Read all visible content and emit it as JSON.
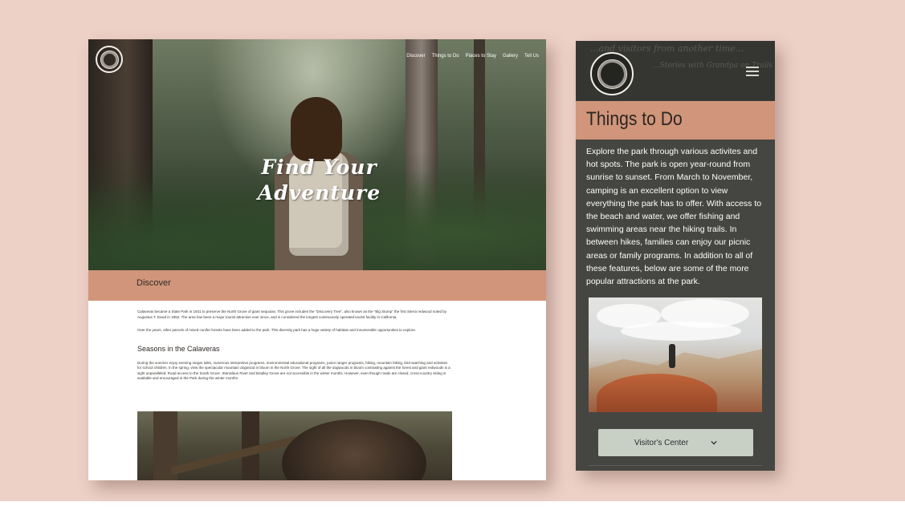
{
  "desktop": {
    "nav": [
      "Discover",
      "Things to Do",
      "Places to Stay",
      "Gallery",
      "Tell Us"
    ],
    "hero_title_line1": "Find Your",
    "hero_title_line2": "Adventure",
    "section_title": "Discover",
    "paragraphs": [
      "Calaveras became a State Park in 1931 to preserve the North Grove of giant sequoias. This grove includes the \"Discovery Tree\", also known as the \"Big Stump\" the first Sierra redwood noted by Augustus T. Dowd in 1852. The area has been a major tourist attraction ever since, and is considered the longest continuously operated tourist facility in California.",
      "Over the years, other parcels of mixed conifer forests have been added to the park. This diversity park has a huge variety of habitats and innumerable opportunities to explore."
    ],
    "subheading": "Seasons in the Calaveras",
    "seasons_paragraph": "During the summer enjoy evening ranger talks, numerous interpretive programs, environmental educational programs, junior ranger programs, hiking, mountain biking, bird watching and activities for school children. In the spring, view the spectacular mountain dogwood in bloom in the North Grove. The sight of all the dogwoods in bloom contrasting against the forest and giant redwoods is a sight unparalleled. Road access to the South Grove, Stanislaus River and Bradley Grove are not accessible in the winter months. However, even though roads are closed, cross-country skiing is available and encouraged in the Park during the winter months."
  },
  "mobile": {
    "ghost_line1": "...and visitors from another time...",
    "ghost_line2": "...Stories with Grandpa on Trails",
    "title": "Things to Do",
    "body": "Explore the park through various activites and hot spots. The park is open year-round from sunrise to sunset. From March to November, camping is an excellent option to view everything the park has to offer. With access to the beach and water, we offer fishing and swimming areas near the hiking trails. In between hikes, families can enjoy our picnic areas or family programs. In addition to all of these features, below are some of the more popular attractions at the park.",
    "button_label": "Visitor's Center"
  },
  "colors": {
    "backdrop": "#edd0c6",
    "accent_band": "#d0957a",
    "mobile_bg": "#454642",
    "button_bg": "#c8d0c6"
  },
  "icons": [
    "logo-icon",
    "hamburger-menu-icon",
    "chevron-down-icon"
  ]
}
